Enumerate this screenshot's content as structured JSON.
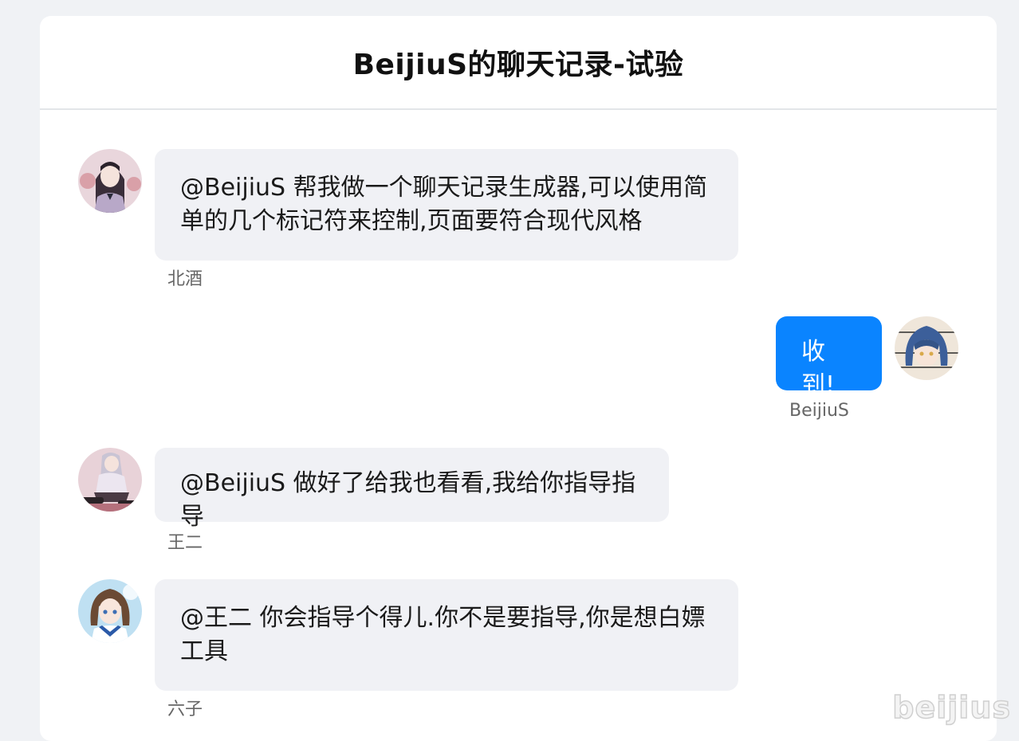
{
  "page": {
    "title": "BeijiuS的聊天记录-试验"
  },
  "messages": [
    {
      "side": "left",
      "text": "@BeijiuS 帮我做一个聊天记录生成器,可以使用简单的几个标记符来控制,页面要符合现代风格",
      "sender": "北酒",
      "avatar": "girl-long-dark-hair-avatar"
    },
    {
      "side": "right",
      "text": "收到!",
      "sender": "BeijiuS",
      "avatar": "girl-blue-hair-avatar"
    },
    {
      "side": "left",
      "text": "@BeijiuS 做好了给我也看看,我给你指导指导",
      "sender": "王二",
      "avatar": "girl-sitting-avatar"
    },
    {
      "side": "left",
      "text": "@王二 你会指导个得儿.你不是要指导,你是想白嫖工具",
      "sender": "六子",
      "avatar": "girl-sailor-uniform-avatar"
    }
  ],
  "watermark": "beijius",
  "colors": {
    "accent": "#0a84ff",
    "bubble_left": "#f0f1f5",
    "page_bg": "#f0f2f5"
  }
}
